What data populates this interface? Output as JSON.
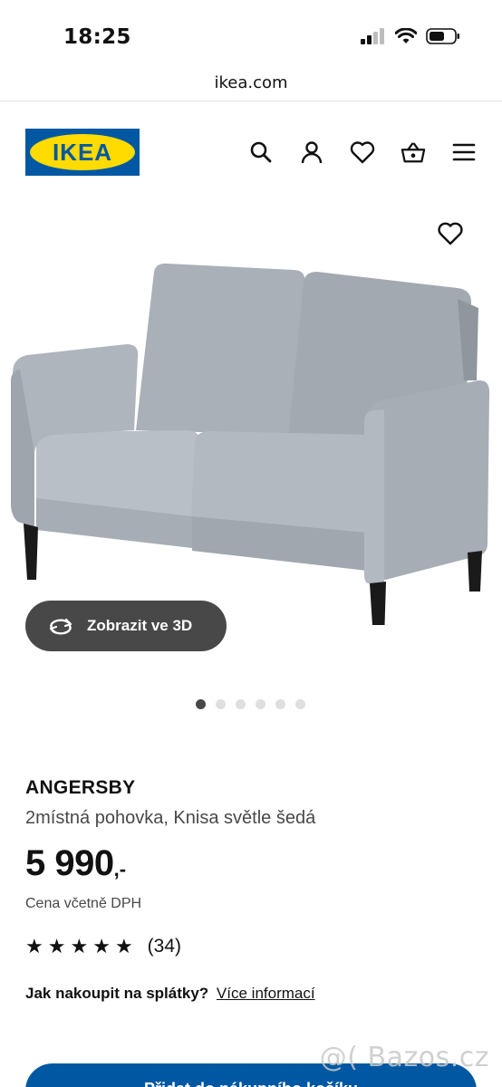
{
  "status_bar": {
    "time": "18:25"
  },
  "browser": {
    "url": "ikea.com"
  },
  "header": {
    "logo_text": "IKEA",
    "icons": [
      "search-icon",
      "account-icon",
      "heart-icon",
      "basket-icon",
      "menu-icon"
    ]
  },
  "gallery": {
    "view_3d_label": "Zobrazit ve 3D",
    "image_count": 6,
    "active_index": 0
  },
  "product": {
    "name": "ANGERSBY",
    "description": "2místná pohovka, Knisa světle šedá",
    "price": "5 990",
    "price_suffix": ",-",
    "vat_note": "Cena včetně DPH",
    "rating_stars": 5,
    "review_count": "(34)",
    "installment_question": "Jak nakoupit na splátky?",
    "installment_link": "Více informací"
  },
  "cta": {
    "add_to_cart": "Přidat do nákupního košíku"
  },
  "watermark": "@( Bazos.cz",
  "colors": {
    "brand_blue": "#0058a3",
    "brand_yellow": "#ffdb00",
    "button_dark": "#484848"
  }
}
